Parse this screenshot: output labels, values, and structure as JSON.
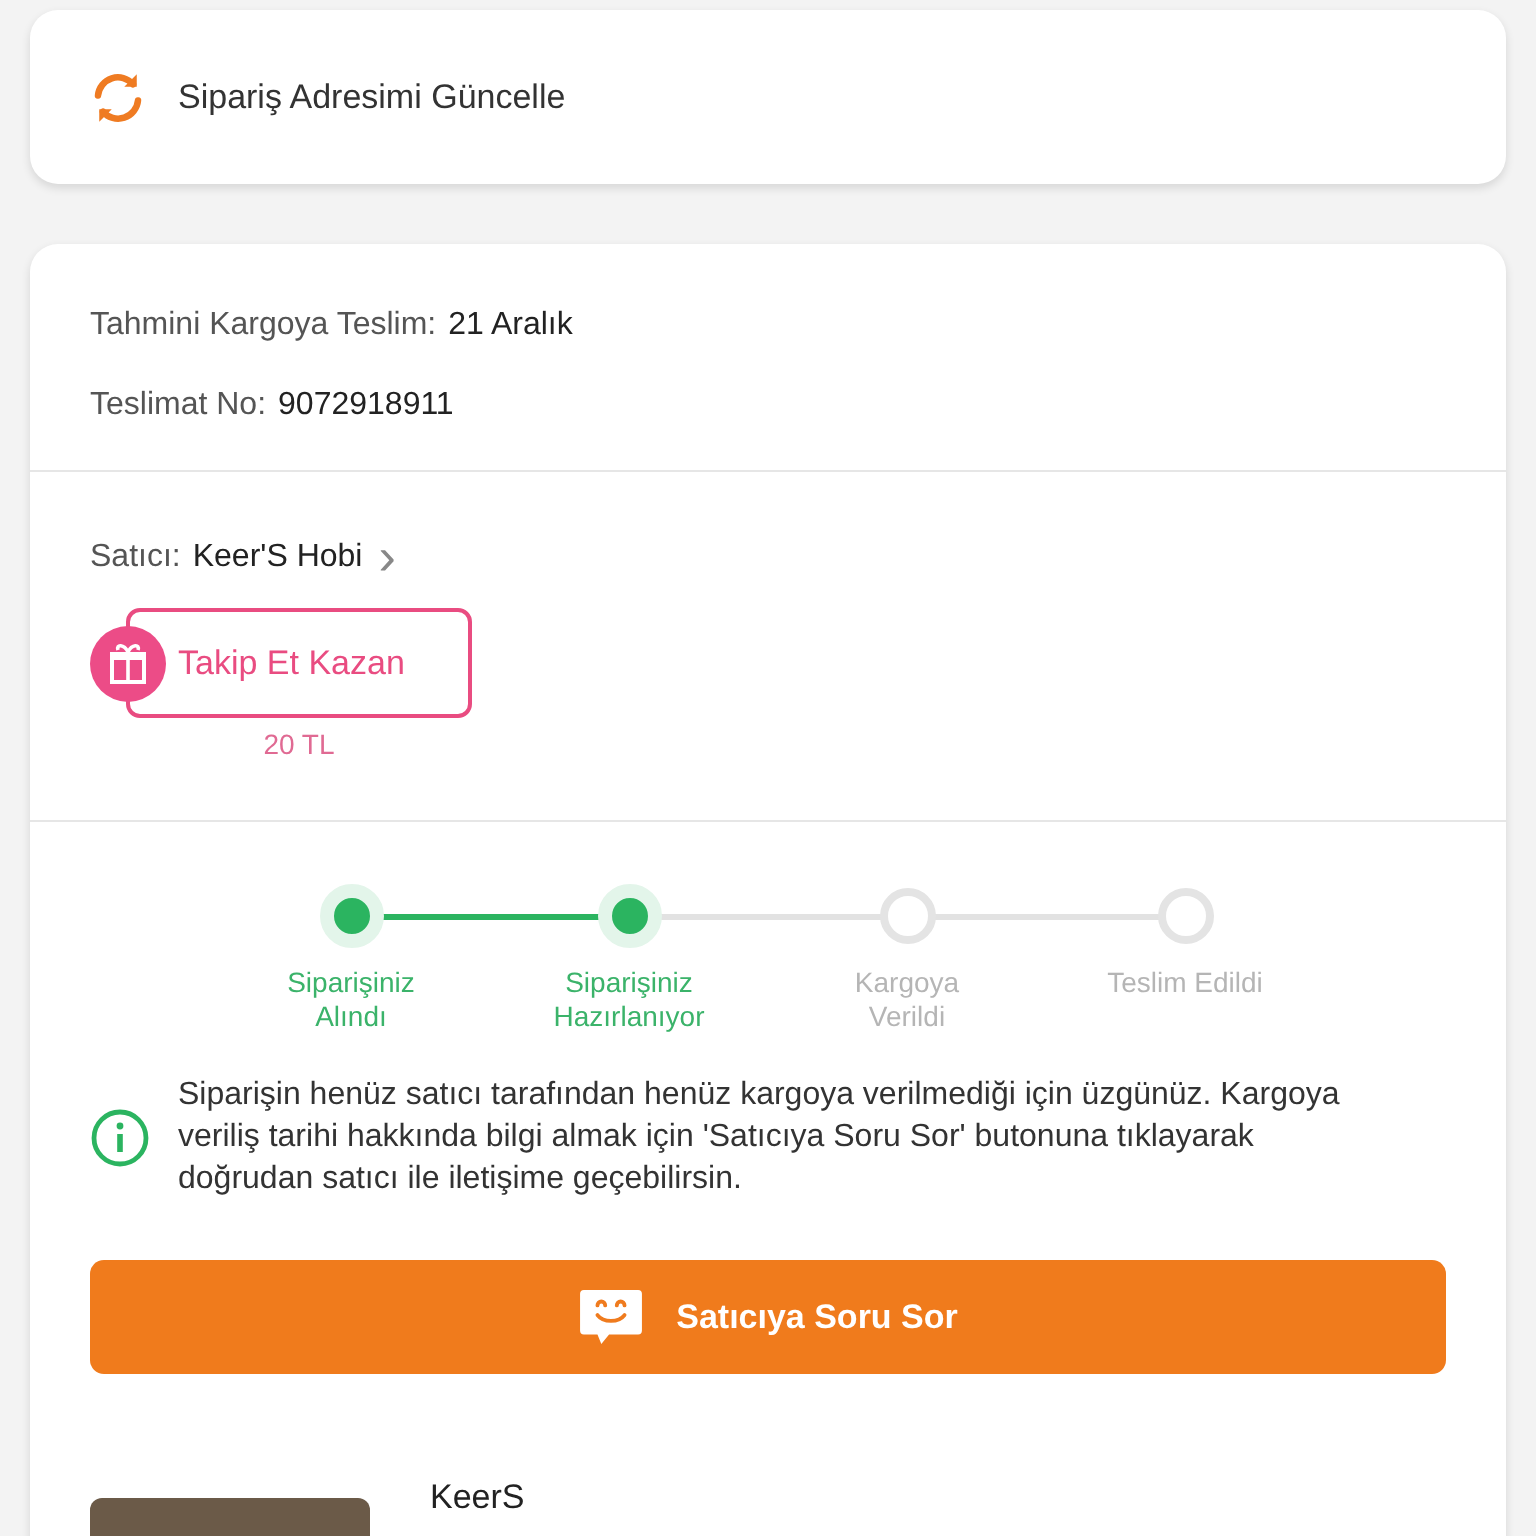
{
  "address_card": {
    "label": "Sipariş Adresimi Güncelle"
  },
  "shipment": {
    "estimate_label": "Tahmini Kargoya Teslim:",
    "estimate_value": "21 Aralık",
    "delivery_label": "Teslimat No:",
    "delivery_value": "9072918911"
  },
  "seller": {
    "label": "Satıcı:",
    "name": "Keer'S Hobi",
    "chevron": "›",
    "follow_button": "Takip Et Kazan",
    "follow_reward": "20 TL"
  },
  "steps": [
    {
      "label": "Siparişiniz Alındı",
      "done": true
    },
    {
      "label": "Siparişiniz Hazırlanıyor",
      "done": true
    },
    {
      "label": "Kargoya Verildi",
      "done": false
    },
    {
      "label": "Teslim Edildi",
      "done": false
    }
  ],
  "notice": "Siparişin henüz satıcı tarafından henüz kargoya verilmediği için üzgünüz. Kargoya veriliş tarihi hakkında bilgi almak için 'Satıcıya Soru Sor' butonuna tıklayarak doğrudan satıcı ile iletişime geçebilirsin.",
  "ask_button": "Satıcıya Soru Sor",
  "product": {
    "name": "KeerS"
  }
}
